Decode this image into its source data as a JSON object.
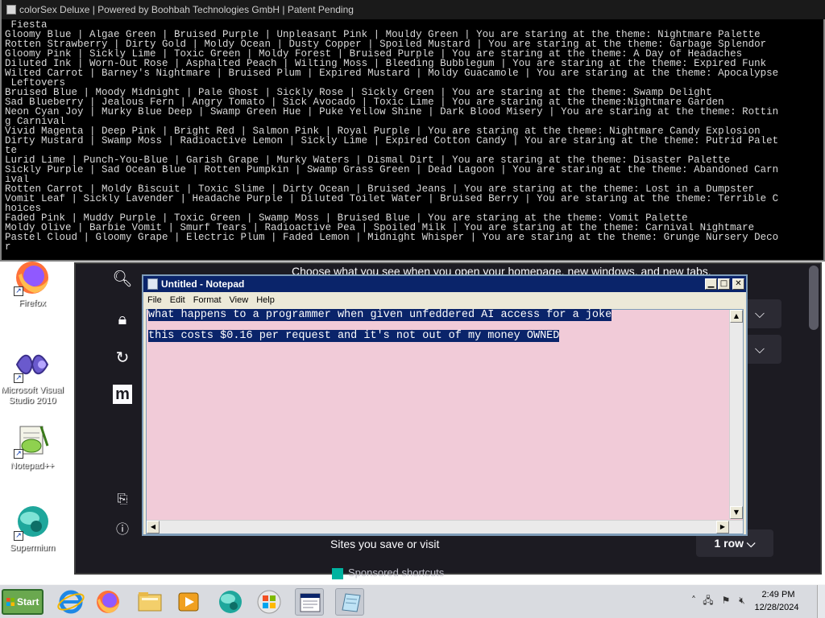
{
  "console": {
    "title": "colorSex Deluxe | Powered by Boohbah Technologies GmbH | Patent Pending",
    "lines": [
      " Fiesta",
      "Gloomy Blue | Algae Green | Bruised Purple | Unpleasant Pink | Mouldy Green | You are staring at the theme: Nightmare Palette",
      "Rotten Strawberry | Dirty Gold | Moldy Ocean | Dusty Copper | Spoiled Mustard | You are staring at the theme: Garbage Splendor",
      "Gloomy Pink | Sickly Lime | Toxic Green | Moldy Forest | Bruised Purple | You are staring at the theme: A Day of Headaches",
      "Diluted Ink | Worn-Out Rose | Asphalted Peach | Wilting Moss | Bleeding Bubblegum | You are staring at the theme: Expired Funk",
      "Wilted Carrot | Barney's Nightmare | Bruised Plum | Expired Mustard | Moldy Guacamole | You are staring at the theme: Apocalypse",
      " Leftovers",
      "Bruised Blue | Moody Midnight | Pale Ghost | Sickly Rose | Sickly Green | You are staring at the theme: Swamp Delight",
      "Sad Blueberry | Jealous Fern | Angry Tomato | Sick Avocado | Toxic Lime | You are staring at the theme:Nightmare Garden",
      "Neon Cyan Joy | Murky Blue Deep | Swamp Green Hue | Puke Yellow Shine | Dark Blood Misery | You are staring at the theme: Rottin",
      "g Carnival",
      "Vivid Magenta | Deep Pink | Bright Red | Salmon Pink | Royal Purple | You are staring at the theme: Nightmare Candy Explosion",
      "Dirty Mustard | Swamp Moss | Radioactive Lemon | Sickly Lime | Expired Cotton Candy | You are staring at the theme: Putrid Palet",
      "te",
      "Lurid Lime | Punch-You-Blue | Garish Grape | Murky Waters | Dismal Dirt | You are staring at the theme: Disaster Palette",
      "Sickly Purple | Sad Ocean Blue | Rotten Pumpkin | Swamp Grass Green | Dead Lagoon | You are staring at the theme: Abandoned Carn",
      "ival",
      "Rotten Carrot | Moldy Biscuit | Toxic Slime | Dirty Ocean | Bruised Jeans | You are staring at the theme: Lost in a Dumpster",
      "Vomit Leaf | Sickly Lavender | Headache Purple | Diluted Toilet Water | Bruised Berry | You are staring at the theme: Terrible C",
      "hoices",
      "Faded Pink | Muddy Purple | Toxic Green | Swamp Moss | Bruised Blue | You are staring at the theme: Vomit Palette",
      "Moldy Olive | Barbie Vomit | Smurf Tears | Radioactive Pea | Spoiled Milk | You are staring at the theme: Carnival Nightmare",
      "Pastel Cloud | Gloomy Grape | Electric Plum | Faded Lemon | Midnight Whisper | You are staring at the theme: Grunge Nursery Deco",
      "r"
    ]
  },
  "browser": {
    "top_text": "Choose what you see when you open your homepage, new windows, and new tabs.",
    "sites_label": "Sites you save or visit",
    "rows_value": "1 row",
    "sponsored_label": "Sponsored shortcuts",
    "rail_letter": "m"
  },
  "desktop": {
    "icons": [
      {
        "label": "Firefox"
      },
      {
        "label": "Microsoft Visual Studio 2010"
      },
      {
        "label": "Notepad++"
      },
      {
        "label": "Supermium"
      }
    ]
  },
  "notepad": {
    "title": "Untitled - Notepad",
    "menu": [
      "File",
      "Edit",
      "Format",
      "View",
      "Help"
    ],
    "lines": [
      "what happens to a programmer when given unfeddered AI access for a joke",
      "this costs $0.16 per request and it's not out of my money OWNED"
    ],
    "background_color": "#f1cbd8",
    "selection_color": "#0a246a"
  },
  "taskbar": {
    "start_label": "Start",
    "apps": [
      "internet-explorer-icon",
      "firefox-icon",
      "file-explorer-icon",
      "media-player-icon",
      "supermium-icon",
      "windows-update-icon",
      "notepad-window-icon",
      "notepad-icon"
    ],
    "time": "2:49 PM",
    "date": "12/28/2024"
  },
  "colors": {
    "console_bg": "#000000",
    "console_text": "#d9d9d9",
    "browser_bg": "#1c1b22",
    "notepad_title": "#0a246a",
    "taskbar_bg": "#d9dbe0",
    "start_green": "#6aa84f"
  }
}
